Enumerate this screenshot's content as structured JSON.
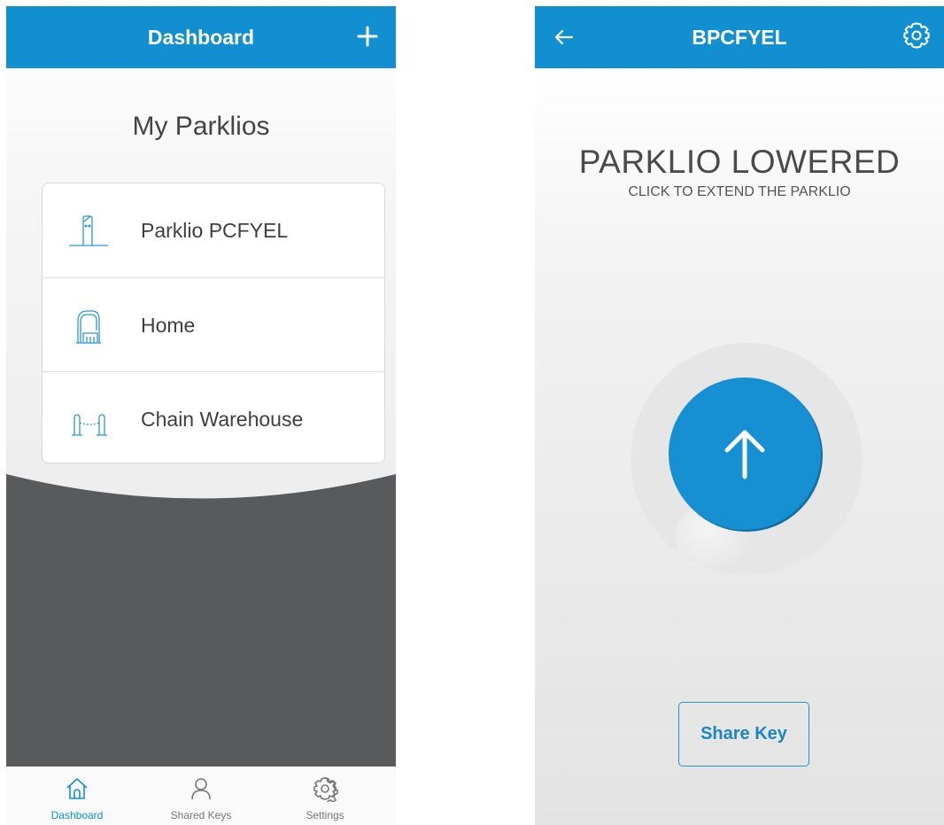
{
  "colors": {
    "accent": "#118fd1",
    "dark_panel": "#595a5c",
    "text": "#444444"
  },
  "dashboard": {
    "title": "Dashboard",
    "add_icon": "plus-icon",
    "section_title": "My Parklios",
    "items": [
      {
        "label": "Parklio PCFYEL",
        "icon": "parking-barrier-icon"
      },
      {
        "label": "Home",
        "icon": "garage-gate-icon"
      },
      {
        "label": "Chain Warehouse",
        "icon": "chain-barrier-icon"
      }
    ],
    "nav": [
      {
        "label": "Dashboard",
        "icon": "home-icon",
        "active": true
      },
      {
        "label": "Shared Keys",
        "icon": "user-icon",
        "active": false
      },
      {
        "label": "Settings",
        "icon": "gear-icon",
        "active": false
      }
    ]
  },
  "detail": {
    "title": "BPCFYEL",
    "back_icon": "arrow-left-icon",
    "settings_icon": "gear-icon",
    "status": "PARKLIO LOWERED",
    "hint": "CLICK TO EXTEND THE PARKLIO",
    "action_icon": "arrow-up-icon",
    "share_label": "Share Key"
  }
}
